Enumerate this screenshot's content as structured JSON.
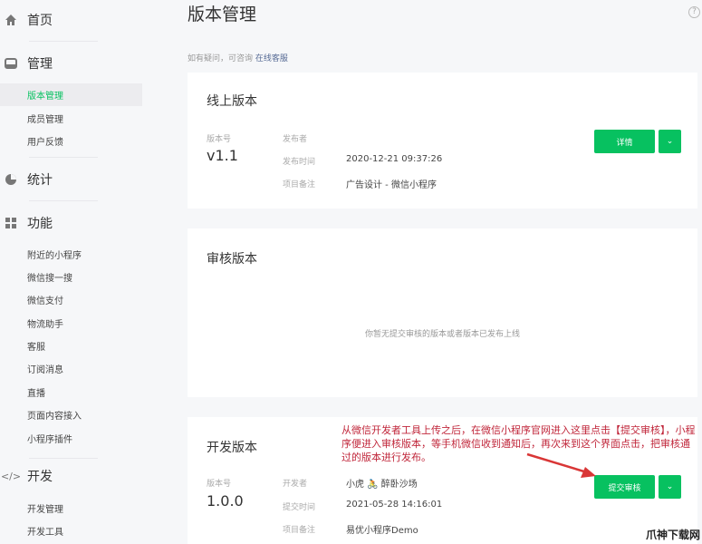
{
  "sidebar": {
    "sections": [
      {
        "label": "首页",
        "icon": "home-icon"
      },
      {
        "label": "管理",
        "icon": "inbox-icon"
      },
      {
        "label": "统计",
        "icon": "pie-chart-icon"
      },
      {
        "label": "功能",
        "icon": "grid-icon"
      },
      {
        "label": "开发",
        "icon": "code-icon"
      }
    ],
    "manage_items": [
      "版本管理",
      "成员管理",
      "用户反馈"
    ],
    "feature_items": [
      "附近的小程序",
      "微信搜一搜",
      "微信支付",
      "物流助手",
      "客服",
      "订阅消息",
      "直播",
      "页面内容接入",
      "小程序插件"
    ],
    "dev_items": [
      "开发管理",
      "开发工具"
    ]
  },
  "header": {
    "title": "版本管理",
    "help": "?",
    "tip": "如有疑问，可咨询",
    "tip_link": "在线客服"
  },
  "online": {
    "title": "线上版本",
    "version_label": "版本号",
    "version": "v1.1",
    "publisher_label": "发布者",
    "publisher": "",
    "time_label": "发布时间",
    "time": "2020-12-21 09:37:26",
    "remark_label": "项目备注",
    "remark": "广告设计 - 微信小程序",
    "detail_button": "详情"
  },
  "review": {
    "title": "审核版本",
    "empty": "你暂无提交审核的版本或者版本已发布上线"
  },
  "dev": {
    "title": "开发版本",
    "version_label": "版本号",
    "version": "1.0.0",
    "developer_label": "开发者",
    "developer": "小虎 🚴 醉卧沙场",
    "time_label": "提交时间",
    "time": "2021-05-28 14:16:01",
    "remark_label": "项目备注",
    "remark": "易优小程序Demo",
    "submit_button": "提交审核"
  },
  "annotation": "从微信开发者工具上传之后，在微信小程序官网进入这里点击【提交审核】，小程序便进入审核版本，等手机微信收到通知后，再次来到这个界面点击，把审核通过的版本进行发布。",
  "watermark": "爪神下载网",
  "colors": {
    "accent": "#07c160",
    "annotation": "#c0263a"
  }
}
